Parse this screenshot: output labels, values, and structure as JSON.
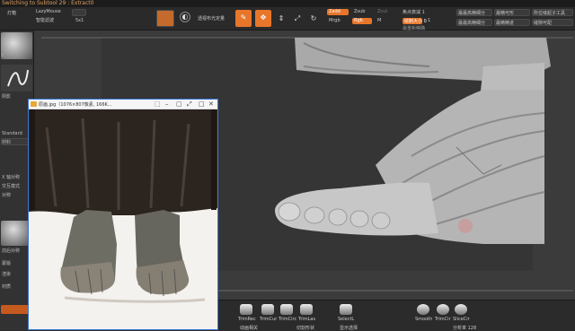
{
  "title": "Switching to Subtool 29 : Extract0",
  "toolbar": {
    "light_box": "灯箱",
    "lazy_mouse": "LazyMouse",
    "lazy_sub": "智能滤波",
    "lazy_value": "5x1",
    "perspective": "透视布光定量",
    "z_add": "Zadd",
    "z_sub": "Zsub",
    "z_cut": "Zcut",
    "mrgb": "Mrgb",
    "rgb": "Rgb",
    "m": "M",
    "focal_label": "焦点衰减 1",
    "focal_value": "1",
    "draw_size_label": "绘制大小 0",
    "dynamic": "最重新精确",
    "right_top_1": "最最高精细分",
    "right_top_2": "最精可形",
    "right_top_3": "所位缝起子工具",
    "right_bot_1": "最最高精细分",
    "right_bot_2": "最精精进",
    "right_bot_3": "缝隙可配"
  },
  "left": {
    "labels": [
      "C",
      "阴影",
      "Standard",
      "材料",
      "X 轴对称",
      "交互模式",
      "对称",
      "前后对称",
      "蒙版",
      "渲染",
      "材质"
    ]
  },
  "image_window": {
    "title": "原画.jpg（1076×807像素, 166K..."
  },
  "bottom": {
    "tools": [
      "TrimRec",
      "TrimCur",
      "TrimCirc",
      "TrimLas",
      "SelectL",
      "Smooth",
      "TrimCir",
      "SliceCir"
    ],
    "sub": [
      "动画相关",
      "切割形状",
      "显示选择"
    ],
    "status": "分析率 128"
  }
}
